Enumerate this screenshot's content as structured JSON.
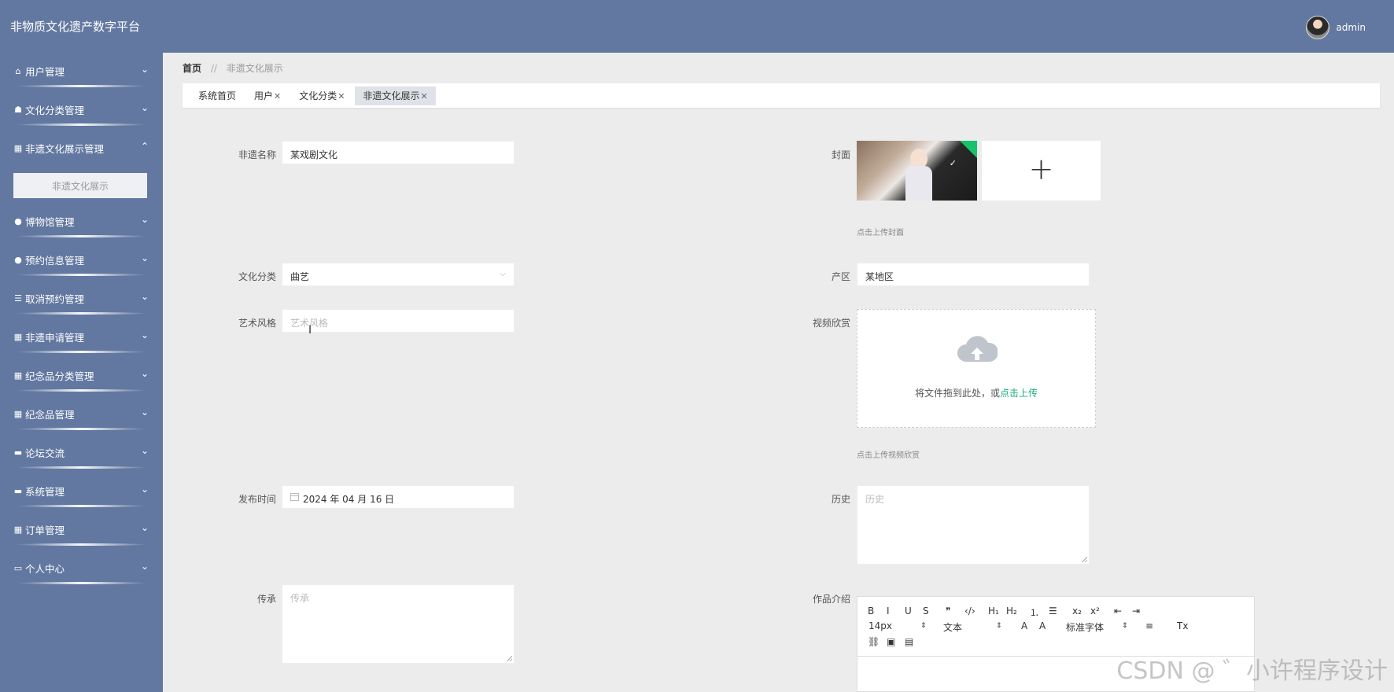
{
  "header": {
    "title": "非物质文化遗产数字平台",
    "username": "admin"
  },
  "sidebar": {
    "items": [
      {
        "label": "用户管理",
        "icon": "⌂",
        "expanded": false
      },
      {
        "label": "文化分类管理",
        "icon": "☗",
        "expanded": false
      },
      {
        "label": "非遗文化展示管理",
        "icon": "▦",
        "expanded": true,
        "sub_label": "非遗文化展示"
      },
      {
        "label": "博物馆管理",
        "icon": "●",
        "expanded": false
      },
      {
        "label": "预约信息管理",
        "icon": "●",
        "expanded": false
      },
      {
        "label": "取消预约管理",
        "icon": "☰",
        "expanded": false
      },
      {
        "label": "非遗申请管理",
        "icon": "▦",
        "expanded": false
      },
      {
        "label": "纪念品分类管理",
        "icon": "▦",
        "expanded": false
      },
      {
        "label": "纪念品管理",
        "icon": "▦",
        "expanded": false
      },
      {
        "label": "论坛交流",
        "icon": "▬",
        "expanded": false
      },
      {
        "label": "系统管理",
        "icon": "▬",
        "expanded": false
      },
      {
        "label": "订单管理",
        "icon": "▦",
        "expanded": false
      },
      {
        "label": "个人中心",
        "icon": "▭",
        "expanded": false
      }
    ],
    "chevron_down": "⌄",
    "chevron_up": "⌃"
  },
  "breadcrumb": {
    "home": "首页",
    "sep": "//",
    "current": "非遗文化展示"
  },
  "tabs": [
    {
      "label": "系统首页",
      "closable": false,
      "active": false
    },
    {
      "label": "用户",
      "closable": true,
      "active": false
    },
    {
      "label": "文化分类",
      "closable": true,
      "active": false
    },
    {
      "label": "非遗文化展示",
      "closable": true,
      "active": true
    }
  ],
  "form": {
    "name": {
      "label": "非遗名称",
      "value": "某戏剧文化"
    },
    "cover": {
      "label": "封面",
      "hint": "点击上传封面",
      "plus": "+",
      "check": "✓"
    },
    "category": {
      "label": "文化分类",
      "value": "曲艺",
      "arrow": "⌵"
    },
    "region": {
      "label": "产区",
      "value": "某地区"
    },
    "style": {
      "label": "艺术风格",
      "placeholder": "艺术风格"
    },
    "video": {
      "label": "视频欣赏",
      "drop_text": "将文件拖到此处，或",
      "drop_link": "点击上传",
      "hint": "点击上传视频欣赏"
    },
    "date": {
      "label": "发布时间",
      "value": "2024 年 04 月 16 日"
    },
    "history": {
      "label": "历史",
      "placeholder": "历史"
    },
    "inherit": {
      "label": "传承",
      "placeholder": "传承"
    },
    "intro": {
      "label": "作品介绍"
    }
  },
  "editor": {
    "row1": [
      "B",
      "I",
      "U",
      "S",
      "❞",
      "‹/›",
      "H₁",
      "H₂",
      "⒈",
      "☰",
      "x₂",
      "x²",
      "⇤",
      "⇥"
    ],
    "font_size": "14px",
    "block": "文本",
    "font_family": "标准字体",
    "row2_icons": [
      "A",
      "A",
      "≡",
      "Tx"
    ],
    "row3": [
      "⛓",
      "▣",
      "▤"
    ],
    "caret": "⇕"
  },
  "watermark": "CSDN @ ゛小许程序设计"
}
